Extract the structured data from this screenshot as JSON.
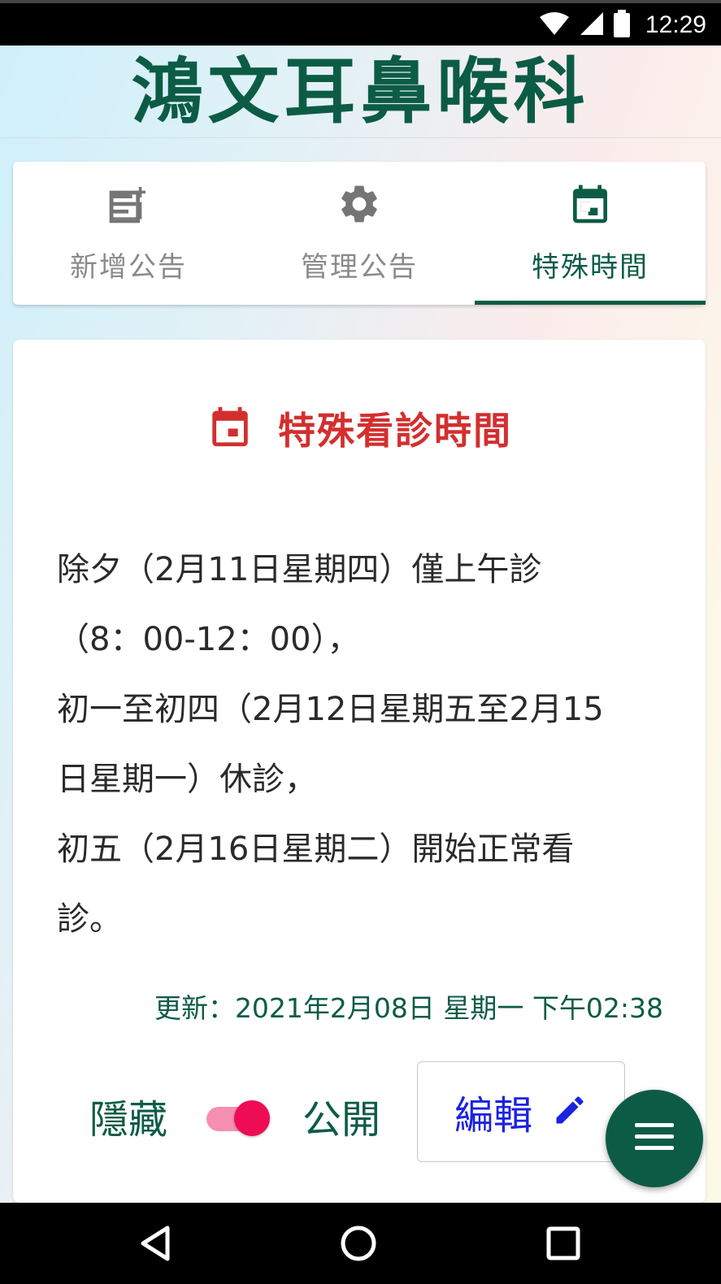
{
  "status_bar": {
    "time": "12:29",
    "icons": [
      "wifi-icon",
      "signal-icon",
      "battery-icon"
    ]
  },
  "app": {
    "title": "鴻文耳鼻喉科",
    "brand_color": "#0c5c45"
  },
  "tabs": [
    {
      "label": "新增公告",
      "icon": "add-note-icon",
      "active": false
    },
    {
      "label": "管理公告",
      "icon": "gear-icon",
      "active": false
    },
    {
      "label": "特殊時間",
      "icon": "calendar-icon",
      "active": true
    }
  ],
  "card": {
    "heading": "特殊看診時間",
    "heading_color": "#d32f2f",
    "lines": [
      "除夕（2月11日星期四）僅上午診",
      "（8：00-12：00），",
      "初一至初四（2月12日星期五至2月15",
      "日星期一）休診，",
      "初五（2月16日星期二）開始正常看",
      "診。"
    ],
    "updated": "更新：2021年2月08日 星期一 下午02:38"
  },
  "controls": {
    "hide_label": "隱藏",
    "public_label": "公開",
    "toggle_on": true,
    "edit_label": "編輯",
    "toggle_color": "#ee0c55"
  },
  "fab": {
    "icon": "menu-icon"
  },
  "nav": {
    "buttons": [
      "back-icon",
      "home-icon",
      "recents-icon"
    ]
  }
}
